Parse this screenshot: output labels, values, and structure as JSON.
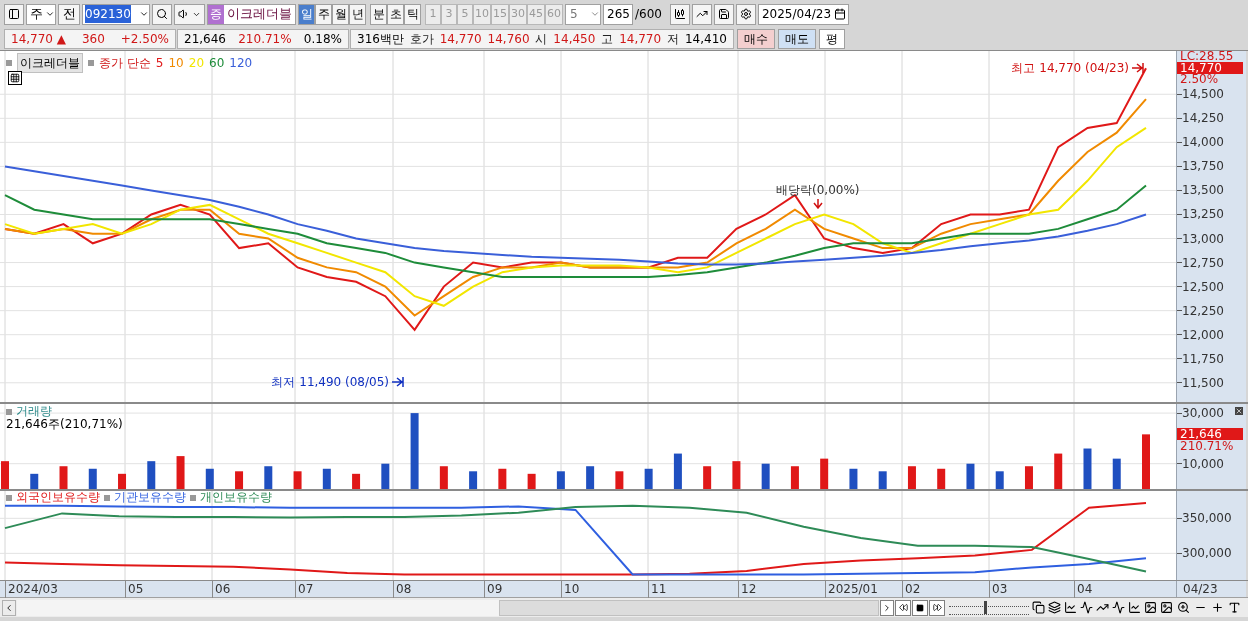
{
  "toolbar": {
    "market": "주",
    "prev_label": "전",
    "code": "092130",
    "badge": "증",
    "name": "이크레더블",
    "periods": [
      {
        "label": "일",
        "selected": true
      },
      {
        "label": "주",
        "selected": false
      },
      {
        "label": "월",
        "selected": false
      },
      {
        "label": "년",
        "selected": false
      }
    ],
    "units": [
      {
        "label": "분",
        "selected": false
      },
      {
        "label": "초",
        "selected": false
      },
      {
        "label": "틱",
        "selected": false
      }
    ],
    "intervals": [
      {
        "label": "1",
        "disabled": true
      },
      {
        "label": "3",
        "disabled": true
      },
      {
        "label": "5",
        "disabled": true
      },
      {
        "label": "10",
        "disabled": true
      },
      {
        "label": "15",
        "disabled": true
      },
      {
        "label": "30",
        "disabled": true
      },
      {
        "label": "45",
        "disabled": true
      },
      {
        "label": "60",
        "disabled": true
      }
    ],
    "interval_value": "5",
    "count": "265",
    "count_total": "/600",
    "date": "2025/04/23"
  },
  "quote": {
    "segments": [
      {
        "items": [
          {
            "text": "14,770 ▲",
            "color": "#d01818"
          },
          {
            "text": "360",
            "color": "#d01818"
          },
          {
            "text": "+2.50%",
            "color": "#d01818"
          }
        ]
      },
      {
        "items": [
          {
            "text": "21,646",
            "color": "#000000"
          },
          {
            "text": "210.71%",
            "color": "#d01818"
          },
          {
            "text": "0.18%",
            "color": "#000000"
          }
        ]
      },
      {
        "items": [
          {
            "text": "316백만",
            "color": "#000000"
          },
          {
            "text": "호가"
          },
          {
            "text": "14,770",
            "color": "#d01818"
          },
          {
            "text": "14,760",
            "color": "#d01818"
          },
          {
            "text": "시"
          },
          {
            "text": "14,450",
            "color": "#d01818"
          },
          {
            "text": "고"
          },
          {
            "text": "14,770",
            "color": "#d01818"
          },
          {
            "text": "저"
          },
          {
            "text": "14,410",
            "color": "#000000"
          }
        ]
      }
    ],
    "buttons": [
      {
        "label": "매수",
        "kind": "buy"
      },
      {
        "label": "매도",
        "kind": "sell"
      },
      {
        "label": "평",
        "kind": "plain"
      }
    ]
  },
  "price_pane": {
    "name": "이크레더블",
    "legend_label": "종가 단순",
    "lc_label": "LC:28.55",
    "last_tag": "14,770",
    "change_tag": "2.50%",
    "markers": [
      {
        "text": "최고 14,770 (04/23)",
        "kind": "high"
      },
      {
        "text": "최저 11,490 (08/05)",
        "kind": "low"
      },
      {
        "text": "배당락(0,00%)",
        "kind": "event"
      }
    ],
    "chart_data": {
      "type": "line",
      "grid": true,
      "ylim": [
        11300,
        14950
      ],
      "yticks": [
        {
          "value": 14500,
          "label": "14,500"
        },
        {
          "value": 14250,
          "label": "14,250"
        },
        {
          "value": 14000,
          "label": "14,000"
        },
        {
          "value": 13750,
          "label": "13,750"
        },
        {
          "value": 13500,
          "label": "13,500"
        },
        {
          "value": 13250,
          "label": "13,250"
        },
        {
          "value": 13000,
          "label": "13,000"
        },
        {
          "value": 12750,
          "label": "12,750"
        },
        {
          "value": 12500,
          "label": "12,500"
        },
        {
          "value": 12250,
          "label": "12,250"
        },
        {
          "value": 12000,
          "label": "12,000"
        },
        {
          "value": 11750,
          "label": "11,750"
        },
        {
          "value": 11500,
          "label": "11,500"
        }
      ],
      "series": [
        {
          "name": "5",
          "color": "#e01818",
          "values": [
            13100,
            13050,
            13150,
            12950,
            13050,
            13250,
            13350,
            13250,
            12900,
            12950,
            12700,
            12600,
            12550,
            12400,
            12050,
            12500,
            12750,
            12700,
            12750,
            12750,
            12700,
            12700,
            12700,
            12800,
            12800,
            13100,
            13250,
            13450,
            13000,
            12900,
            12850,
            12900,
            13150,
            13250,
            13250,
            13300,
            13950,
            14150,
            14200,
            14770
          ]
        },
        {
          "name": "10",
          "color": "#f08a00",
          "values": [
            13100,
            13050,
            13100,
            13050,
            13050,
            13200,
            13300,
            13300,
            13050,
            13000,
            12800,
            12700,
            12650,
            12500,
            12200,
            12400,
            12600,
            12700,
            12700,
            12750,
            12700,
            12700,
            12700,
            12700,
            12750,
            12950,
            13100,
            13300,
            13100,
            13000,
            12900,
            12900,
            13050,
            13150,
            13200,
            13250,
            13600,
            13900,
            14100,
            14450
          ]
        },
        {
          "name": "20",
          "color": "#f2e600",
          "values": [
            13150,
            13050,
            13100,
            13150,
            13050,
            13150,
            13300,
            13350,
            13200,
            13050,
            12950,
            12850,
            12750,
            12650,
            12400,
            12300,
            12500,
            12650,
            12700,
            12720,
            12720,
            12720,
            12700,
            12650,
            12700,
            12850,
            13000,
            13150,
            13250,
            13150,
            12950,
            12850,
            12950,
            13050,
            13150,
            13250,
            13300,
            13600,
            13950,
            14150
          ]
        },
        {
          "name": "60",
          "color": "#1e8c3a",
          "values": [
            13450,
            13300,
            13250,
            13200,
            13200,
            13200,
            13200,
            13200,
            13150,
            13100,
            13050,
            12950,
            12900,
            12850,
            12750,
            12700,
            12650,
            12600,
            12600,
            12600,
            12600,
            12600,
            12600,
            12620,
            12650,
            12700,
            12750,
            12820,
            12900,
            12950,
            12950,
            12950,
            13000,
            13050,
            13050,
            13050,
            13100,
            13200,
            13300,
            13550
          ]
        },
        {
          "name": "120",
          "color": "#3a5fd9",
          "values": [
            13750,
            13700,
            13650,
            13600,
            13550,
            13500,
            13450,
            13400,
            13330,
            13250,
            13150,
            13080,
            13000,
            12950,
            12900,
            12870,
            12850,
            12830,
            12810,
            12800,
            12790,
            12780,
            12760,
            12740,
            12730,
            12730,
            12740,
            12760,
            12780,
            12800,
            12820,
            12850,
            12880,
            12920,
            12950,
            12980,
            13020,
            13080,
            13150,
            13250
          ]
        }
      ]
    }
  },
  "volume_pane": {
    "title": "거래량",
    "summary": "21,646주(210,71%)",
    "last_tag": "21,646",
    "ratio_tag": "210.71%",
    "chart_data": {
      "type": "bar",
      "grid": true,
      "ylim": [
        0,
        33600
      ],
      "yticks": [
        {
          "value": 30000,
          "label": "30,000"
        },
        {
          "value": 10000,
          "label": "10,000"
        }
      ],
      "series": [
        {
          "color": "#e01818",
          "values": [
            11000,
            null,
            9000,
            null,
            6000,
            null,
            13000,
            null,
            7000,
            null,
            7000,
            null,
            6000,
            null,
            null,
            9000,
            null,
            8000,
            6000,
            null,
            null,
            7000,
            null,
            null,
            9000,
            11000,
            null,
            9000,
            12000,
            null,
            null,
            9000,
            8000,
            null,
            null,
            9000,
            14000,
            null,
            null,
            21600
          ]
        },
        {
          "color": "#1f4fc0",
          "values": [
            null,
            6000,
            null,
            8000,
            null,
            11000,
            null,
            8000,
            null,
            9000,
            null,
            8000,
            null,
            10000,
            30000,
            null,
            7000,
            null,
            null,
            7000,
            9000,
            null,
            8000,
            14000,
            null,
            null,
            10000,
            null,
            null,
            8000,
            7000,
            null,
            null,
            10000,
            7000,
            null,
            null,
            16000,
            12000,
            null
          ]
        }
      ]
    }
  },
  "holdings_pane": {
    "chart_data": {
      "type": "line",
      "grid": true,
      "ylim": [
        262000,
        389000
      ],
      "yticks": [
        {
          "value": 350000,
          "label": "350,000"
        },
        {
          "value": 300000,
          "label": "300,000"
        }
      ],
      "series": [
        {
          "name": "외국인보유수량",
          "color": "#e01818",
          "values": [
            287000,
            285000,
            283000,
            282000,
            281000,
            277000,
            272000,
            270000,
            270000,
            270000,
            270000,
            270000,
            271000,
            275000,
            285000,
            290000,
            293000,
            297000,
            305000,
            365000,
            372000
          ]
        },
        {
          "name": "기관보유수량",
          "color": "#2f5fe0",
          "values": [
            368000,
            368000,
            367000,
            366000,
            366000,
            365000,
            365000,
            365000,
            365000,
            367000,
            362000,
            270000,
            270000,
            270000,
            270000,
            271000,
            272000,
            273000,
            280000,
            285000,
            293000
          ]
        },
        {
          "name": "개인보유수량",
          "color": "#2e8b57",
          "values": [
            336000,
            357000,
            353000,
            352000,
            352000,
            351000,
            352000,
            352000,
            354000,
            358000,
            366000,
            368000,
            365000,
            358000,
            338000,
            322000,
            311000,
            311000,
            309000,
            292000,
            274000
          ]
        }
      ]
    }
  },
  "x_axis": {
    "labels": [
      "2024/03",
      "05",
      "06",
      "07",
      "08",
      "09",
      "10",
      "11",
      "12",
      "2025/01",
      "02",
      "03",
      "04"
    ],
    "end_date": "04/23"
  },
  "bottom_bar": {
    "zoom": {
      "level": 0.45
    }
  }
}
